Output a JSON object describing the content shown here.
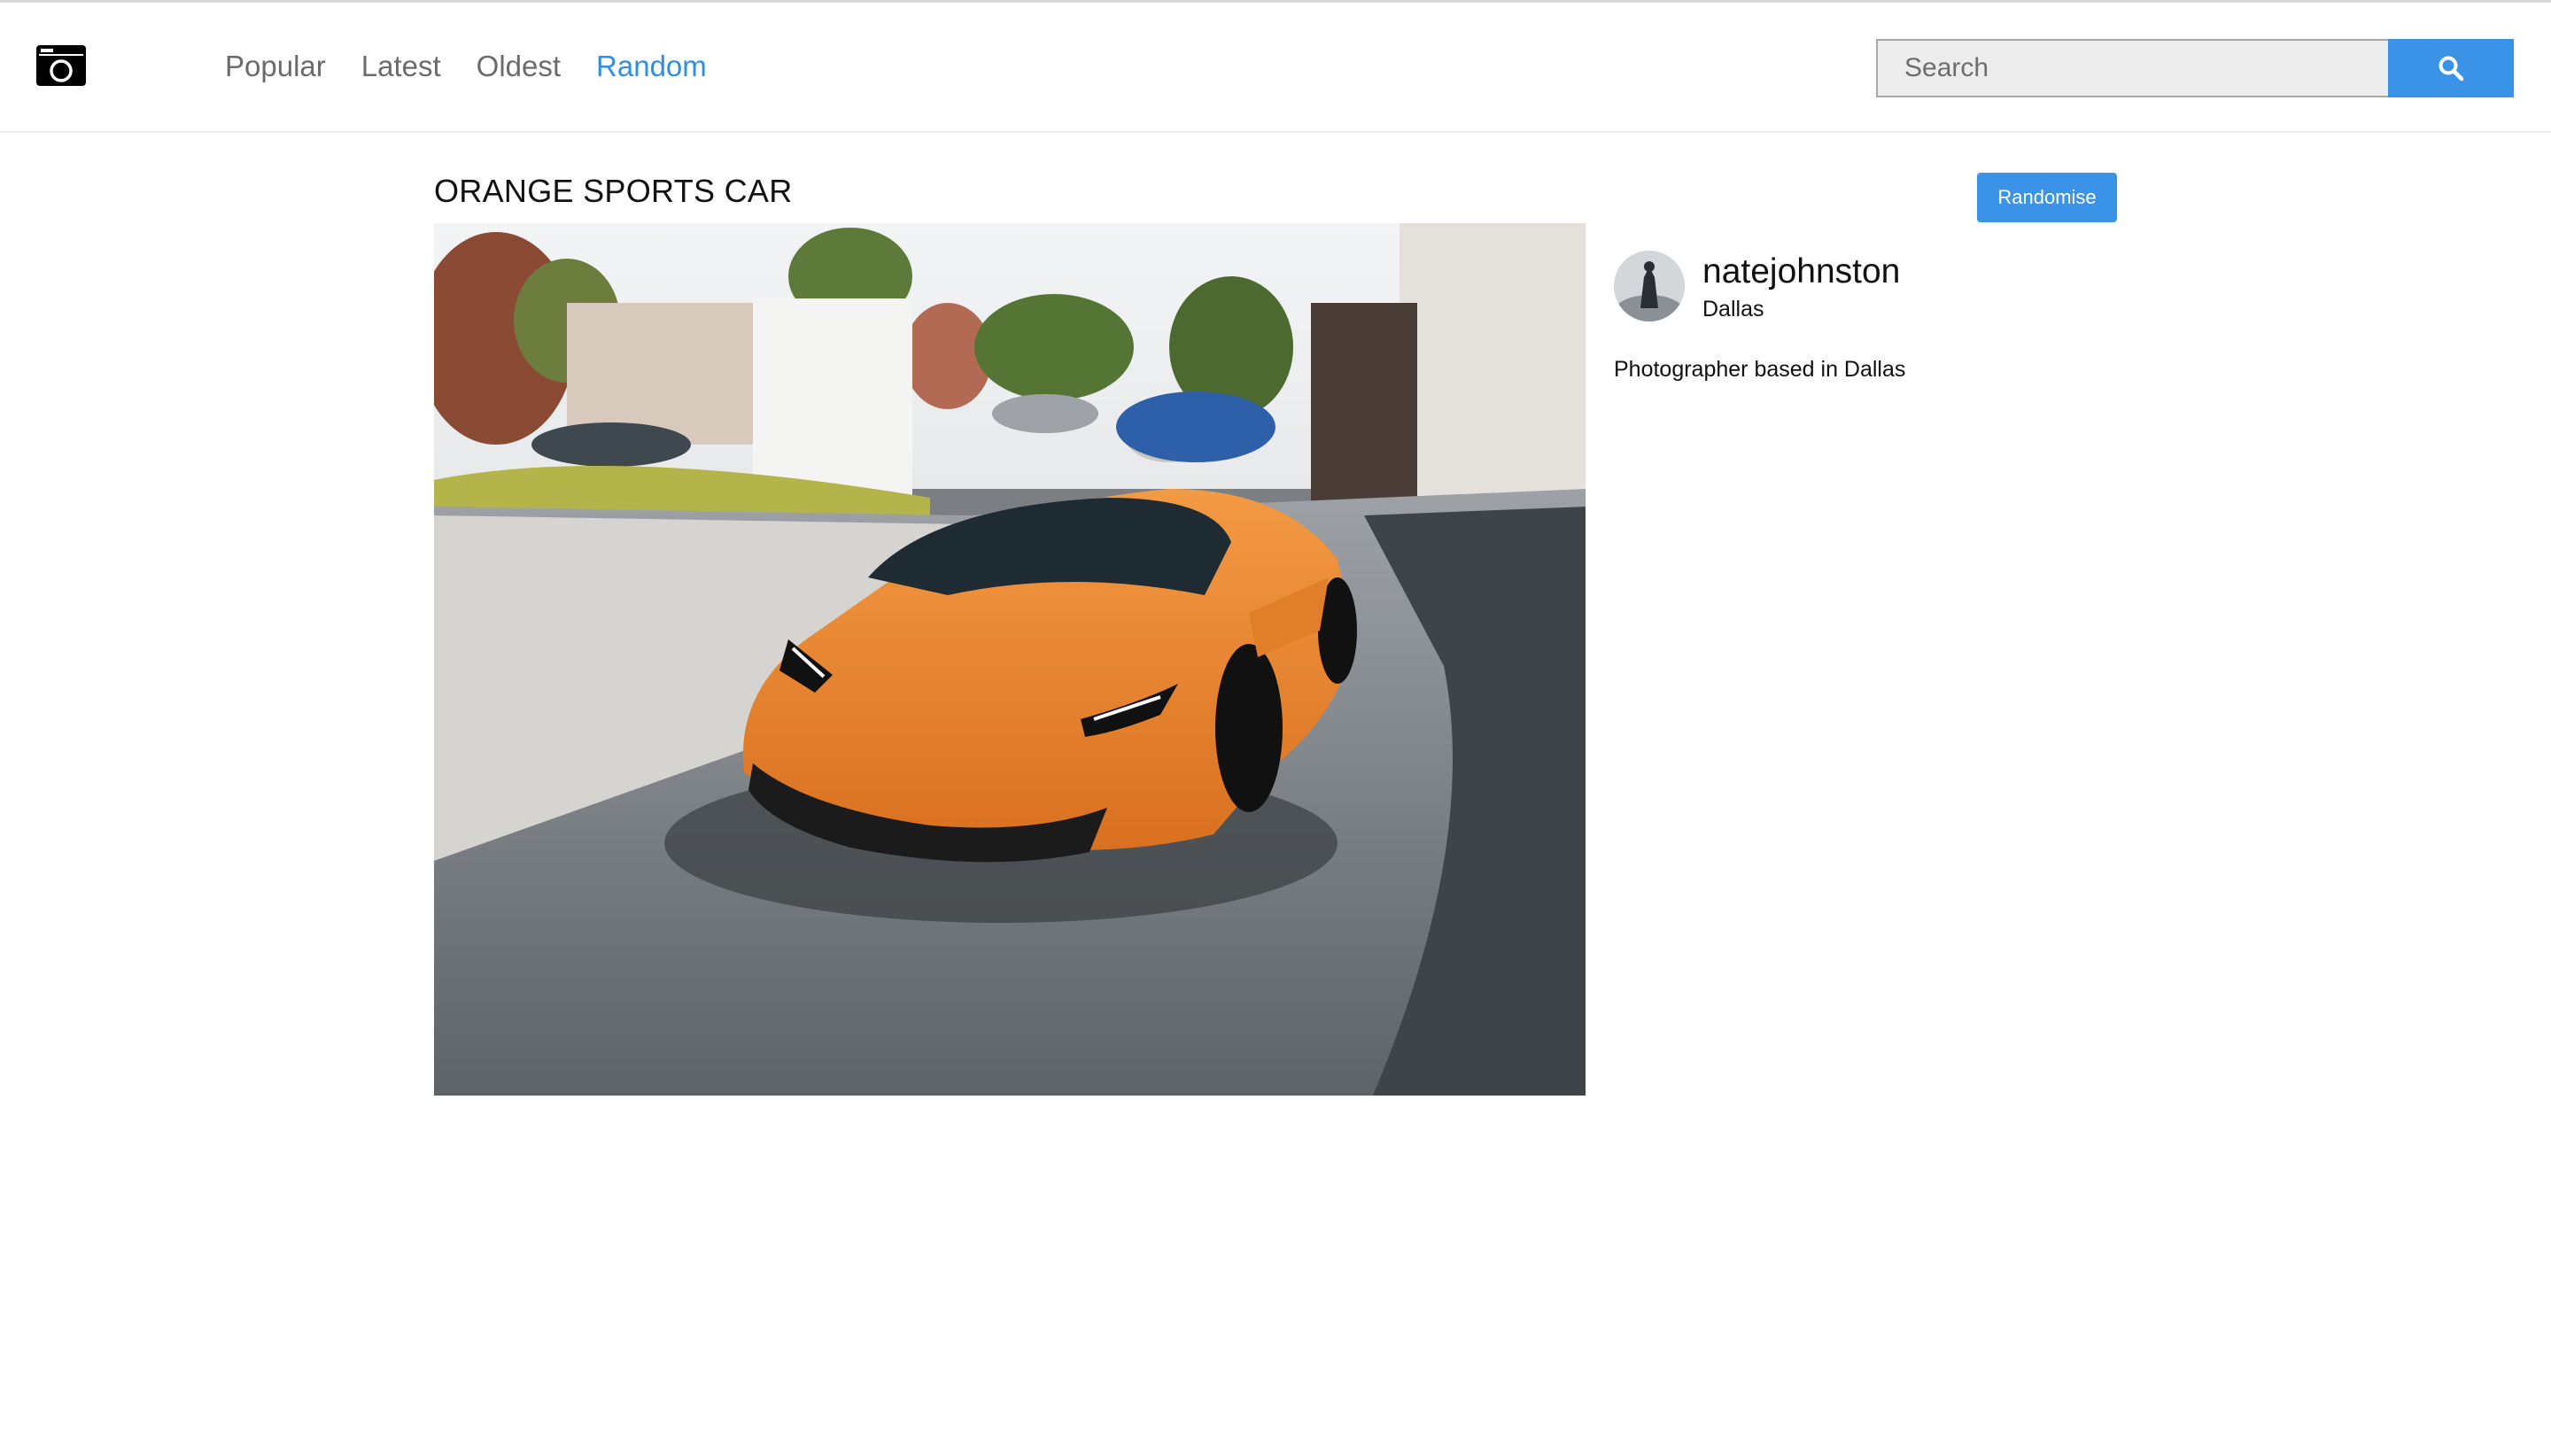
{
  "header": {
    "logo_icon": "camera-icon",
    "nav": [
      {
        "label": "Popular",
        "active": false
      },
      {
        "label": "Latest",
        "active": false
      },
      {
        "label": "Oldest",
        "active": false
      },
      {
        "label": "Random",
        "active": true
      }
    ],
    "search": {
      "placeholder": "Search",
      "value": "",
      "button_icon": "search-icon"
    }
  },
  "photo": {
    "title": "ORANGE SPORTS CAR",
    "randomise_label": "Randomise"
  },
  "author": {
    "username": "natejohnston",
    "location": "Dallas",
    "bio": "Photographer based in Dallas"
  },
  "colors": {
    "accent": "#3b93e8",
    "active_nav": "#2f8fe6",
    "nav_text": "#6b6b6b",
    "search_bg": "#ededed"
  }
}
